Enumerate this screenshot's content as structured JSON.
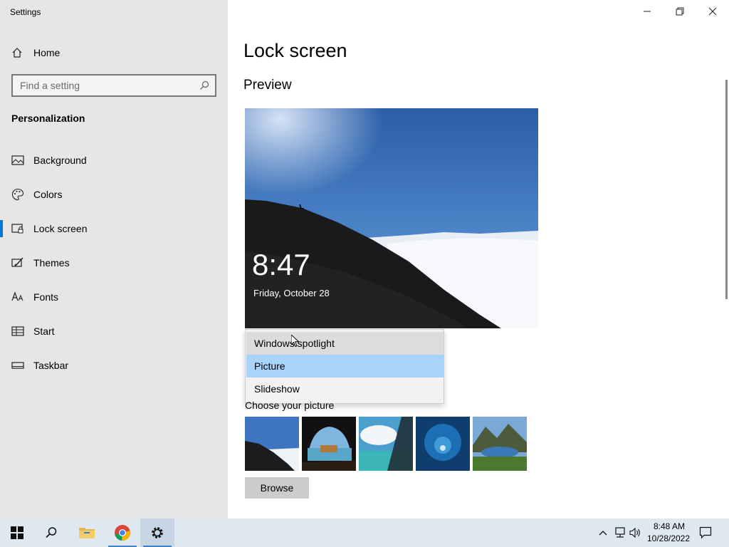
{
  "window": {
    "title": "Settings"
  },
  "sidebar": {
    "home_label": "Home",
    "search_placeholder": "Find a setting",
    "section_title": "Personalization",
    "items": [
      {
        "label": "Background",
        "icon": "image-icon"
      },
      {
        "label": "Colors",
        "icon": "palette-icon"
      },
      {
        "label": "Lock screen",
        "icon": "lock-screen-icon",
        "active": true
      },
      {
        "label": "Themes",
        "icon": "themes-icon"
      },
      {
        "label": "Fonts",
        "icon": "fonts-icon"
      },
      {
        "label": "Start",
        "icon": "start-icon"
      },
      {
        "label": "Taskbar",
        "icon": "taskbar-icon"
      }
    ]
  },
  "main": {
    "title": "Lock screen",
    "preview_heading": "Preview",
    "preview": {
      "time": "8:47",
      "date": "Friday, October 28"
    },
    "background_dropdown": {
      "options": [
        "Windows spotlight",
        "Picture",
        "Slideshow"
      ],
      "hovered": "Windows spotlight",
      "selected": "Picture"
    },
    "choose_picture_label": "Choose your picture",
    "browse_label": "Browse"
  },
  "taskbar": {
    "clock_time": "8:48 AM",
    "clock_date": "10/28/2022"
  },
  "colors": {
    "accent": "#0078d7",
    "sidebar_bg": "#e6e6e6",
    "dropdown_selected": "#a9d3fb",
    "taskbar_bg": "#dfe8f1"
  }
}
